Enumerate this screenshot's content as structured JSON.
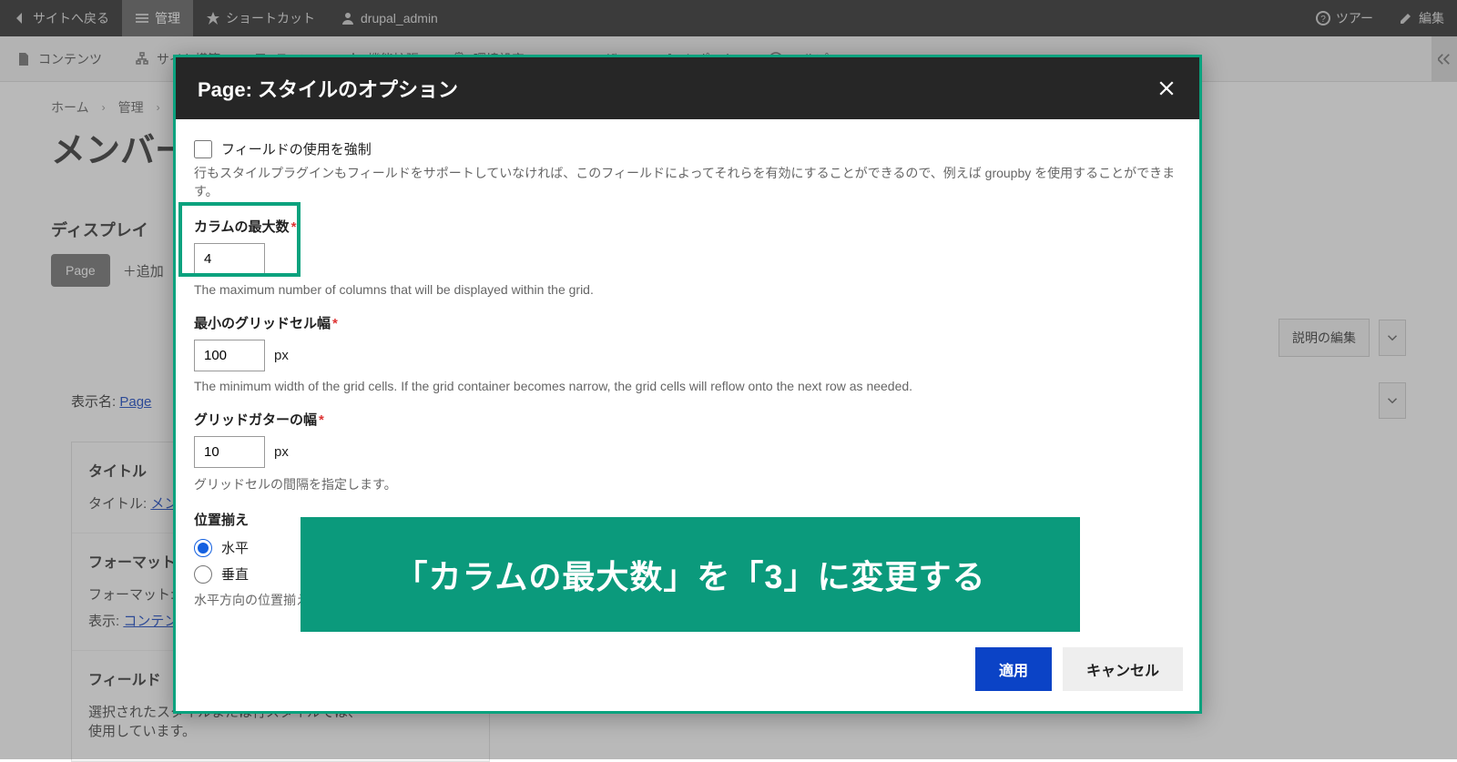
{
  "toolbar": {
    "back": "サイトへ戻る",
    "manage": "管理",
    "shortcuts": "ショートカット",
    "user": "drupal_admin",
    "tour": "ツアー",
    "edit": "編集"
  },
  "secondary": {
    "content": "コンテンツ",
    "structure": "サイト構築",
    "theme": "テーマ",
    "extend": "機能拡張",
    "config": "環境設定",
    "people": "ユーザー",
    "reports": "レポート",
    "help": "ヘルプ"
  },
  "breadcrumb": {
    "home": "ホーム",
    "manage": "管理"
  },
  "page": {
    "title": "メンバー",
    "display_heading": "ディスプレイ",
    "page_btn": "Page",
    "add_display": "＋追加",
    "edit_desc": "説明の編集",
    "display_name_label": "表示名:",
    "display_name_value": "Page"
  },
  "panels": {
    "title": {
      "heading": "タイトル",
      "label": "タイトル:",
      "value": "メンバー"
    },
    "format": {
      "heading": "フォーマット",
      "label": "フォーマット:",
      "display_label": "表示:",
      "display_value": "コンテンツ"
    },
    "fields": {
      "heading": "フィールド",
      "desc": "選択されたスタイルまたは行スタイルでは、",
      "desc2": "使用しています。"
    }
  },
  "modal": {
    "title": "Page: スタイルのオプション",
    "force_label": "フィールドの使用を強制",
    "force_desc": "行もスタイルプラグインもフィールドをサポートしていなければ、このフィールドによってそれらを有効にすることができるので、例えば groupby を使用することができます。",
    "cols_label": "カラムの最大数",
    "cols_value": "4",
    "cols_help": "The maximum number of columns that will be displayed within the grid.",
    "minw_label": "最小のグリッドセル幅",
    "minw_value": "100",
    "minw_help": "The minimum width of the grid cells. If the grid container becomes narrow, the grid cells will reflow onto the next row as needed.",
    "gutter_label": "グリッドガターの幅",
    "gutter_value": "10",
    "gutter_help": "グリッドセルの間隔を指定します。",
    "unit_px": "px",
    "align_label": "位置揃え",
    "align_h": "水平",
    "align_v": "垂直",
    "align_help": "水平方向の位置揃え",
    "apply": "適用",
    "cancel": "キャンセル"
  },
  "banner": {
    "text": "「カラムの最大数」を「3」に変更する"
  }
}
